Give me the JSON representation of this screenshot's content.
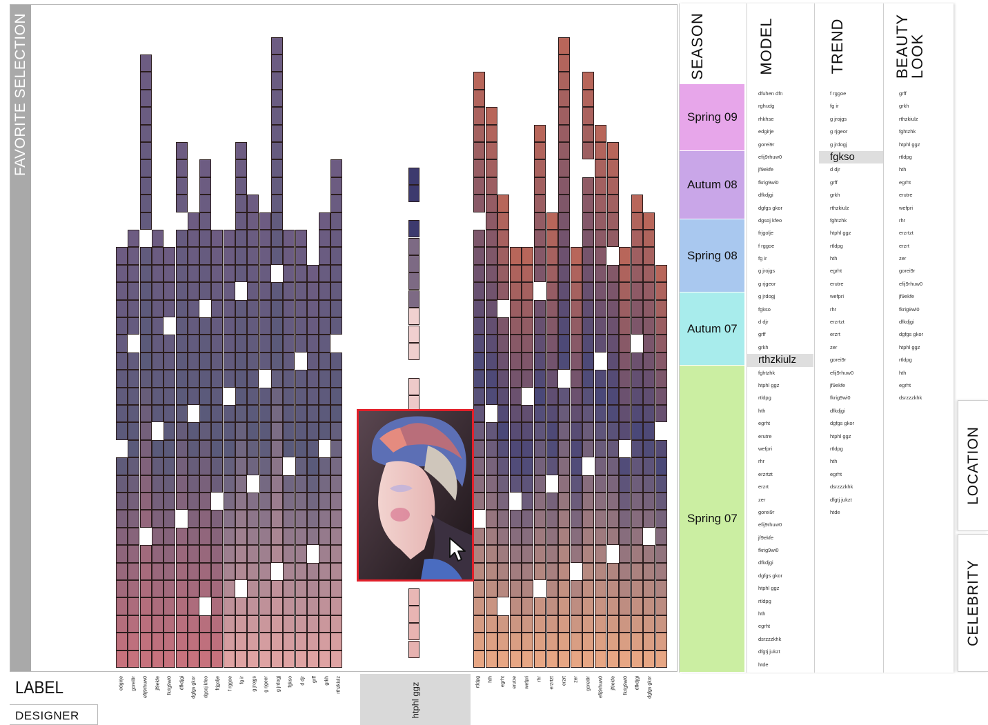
{
  "sidebar": {
    "favorite_label": "FAVORITE SELECTION"
  },
  "bottom": {
    "label_title": "LABEL",
    "designer_title": "DESIGNER",
    "selected_column": "htphl ggz",
    "column_labels_left": [
      "edgirje",
      "gorei9r",
      "efij9rhuw0",
      "jf9ekfe",
      "fkrig9wi0",
      "dfkdjgi",
      "dgfgs gkor",
      "dgsoj kfeo",
      "frjgolje",
      "f rggoe",
      "fg ir",
      "g jrojgs",
      "g rjgeer",
      "g jrdogj",
      "fgkso",
      "d djr",
      "grff",
      "grkh",
      "rthzkiulz"
    ],
    "column_labels_right": [
      "rtldpg",
      "hth",
      "egrht",
      "erutre",
      "wefpri",
      "rhr",
      "erzrtzt",
      "erzrt",
      "zer",
      "gorei9r",
      "efij9rhuw0",
      "jf9ekfe",
      "fkrig9wi0",
      "dfkdjgi",
      "dgfgs gkor"
    ]
  },
  "season": {
    "title": "SEASON",
    "items": [
      {
        "label": "Spring 09",
        "color": "#e7a6ea"
      },
      {
        "label": "Autum 08",
        "color": "#c9a6e8"
      },
      {
        "label": "Spring 08",
        "color": "#a9c8ef"
      },
      {
        "label": "Autum 07",
        "color": "#a8ecec"
      },
      {
        "label": "Spring 07",
        "color": "#cbeea2"
      }
    ]
  },
  "model": {
    "title": "MODEL",
    "items": [
      "dfuhen dfn",
      "rghudg",
      "rhkhse",
      "edgirje",
      "gorei9r",
      "efij9rhuw0",
      "jf9ekfe",
      "fkrig9wi0",
      "dfkdjgi",
      "dgfgs gkor",
      "dgsoj kfeo",
      "frjgolje",
      "f rggoe",
      "fg ir",
      "g jrojgs",
      "g rjgeor",
      "g jrdogj",
      "fgkso",
      "d djr",
      "grff",
      "grkh",
      "rthzkiulz",
      "fghtzhk",
      "htphl ggz",
      "rtldpg",
      "hth",
      "egrht",
      "erutre",
      "wefpri",
      "rhr",
      "erzrtzt",
      "erzrt",
      "zer",
      "gorei9r",
      "efij9rhuw0",
      "jf9ekfe",
      "fkrig9wi0",
      "dfkdjgi",
      "dgfgs gkor",
      "htphl ggz",
      "rtldpg",
      "hth",
      "egrht",
      "dsrzzzkhk",
      "dfgtj jukzt",
      "htde"
    ],
    "selected": "rthzkiulz"
  },
  "trend": {
    "title": "TREND",
    "items": [
      "f rggoe",
      "fg ir",
      "g jrojgs",
      "g rjgeor",
      "g jrdogj",
      "fgkso",
      "d djr",
      "grff",
      "grkh",
      "rthzkiulz",
      "fghtzhk",
      "htphl ggz",
      "rtldpg",
      "hth",
      "egrht",
      "erutre",
      "wefpri",
      "rhr",
      "erzrtzt",
      "erzrt",
      "zer",
      "gorei9r",
      "efij9rhuw0",
      "jf9ekfe",
      "fkrig9wi0",
      "dfkdjgi",
      "dgfgs gkor",
      "htphl ggz",
      "rtldpg",
      "hth",
      "egrht",
      "dsrzzzkhk",
      "dfgtj jukzt",
      "htde"
    ],
    "selected": "fgkso"
  },
  "beauty": {
    "title": [
      "BEAUTY",
      "LOOK"
    ],
    "items": [
      "grff",
      "grkh",
      "rthzkiulz",
      "fghtzhk",
      "htphl ggz",
      "rtldpg",
      "hth",
      "egrht",
      "erutre",
      "wefpri",
      "rhr",
      "erzrtzt",
      "erzrt",
      "zer",
      "gorei9r",
      "efij9rhuw0",
      "jf9ekfe",
      "fkrig9wi0",
      "dfkdjgi",
      "dgfgs gkor",
      "htphl ggz",
      "rtldpg",
      "hth",
      "egrht",
      "dsrzzzkhk"
    ]
  },
  "side_tabs": {
    "location": "LOCATION",
    "celebrity": "CELEBRITY"
  },
  "colors": {
    "popup_border": "#e2202a",
    "favorite_bar": "#a9a9a9"
  }
}
